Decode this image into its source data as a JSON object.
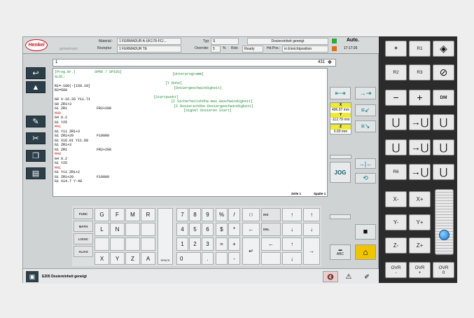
{
  "header": {
    "brand": "Henkel",
    "sub": "gemeinsam",
    "material_label": "Material :",
    "material_value": "1  FERMADUR A-UK178-FC/...",
    "rezeptur_label": "Rezeptur",
    "rezeptur_value": "1  FERMADUR TE",
    "typ_label": "Typ:",
    "typ_value": "S",
    "override_label": "Override:",
    "override_value": "5",
    "override_unit": "%",
    "rob_label": "Rob:",
    "rob_value": "Ready",
    "dosier_value": "Dosiereinheit geneigt",
    "hdpos_label": "Hd.Pos.:",
    "hdpos_value": "in Einrichtposition",
    "mode": "Auto.",
    "time": "17:17:26"
  },
  "toolbar": {
    "field": "1",
    "counter": "431"
  },
  "program": [
    {
      "t": "[Prog.Nr.]         SPR8 / SP10S]",
      "c": "#208a39"
    },
    {
      "t": "%LOC:",
      "c": "#208a39"
    },
    {
      "t": "",
      "c": "#000"
    },
    {
      "t": "R1=-100(-[159.10]",
      "c": "#000"
    },
    {
      "t": "R2=500",
      "c": "#000"
    },
    {
      "t": "",
      "c": "#000"
    },
    {
      "t": "G0 X-16.26 Y11.71",
      "c": "#000"
    },
    {
      "t": "G0 ZR1+3",
      "c": "#000"
    },
    {
      "t": "G1 ZR1              FR2+200",
      "c": "#000"
    },
    {
      "t": "M40",
      "c": "#c21818"
    },
    {
      "t": "G4 0.2",
      "c": "#000"
    },
    {
      "t": "G1 Y25",
      "c": "#000"
    },
    {
      "t": "M41",
      "c": "#c21818"
    },
    {
      "t": "G1 Y11 ZR1+3",
      "c": "#000"
    },
    {
      "t": "G1 ZR1+20           F10000",
      "c": "#000"
    },
    {
      "t": "G1 X16.01 Y11.68",
      "c": "#000"
    },
    {
      "t": "G1 ZR1+3",
      "c": "#000"
    },
    {
      "t": "G1 ZR1              FR2+200",
      "c": "#000"
    },
    {
      "t": "M40",
      "c": "#c21818"
    },
    {
      "t": "G4 0.2",
      "c": "#000"
    },
    {
      "t": "G1 Y25",
      "c": "#000"
    },
    {
      "t": "M41",
      "c": "#c21818"
    },
    {
      "t": "G1 Y11 ZR1+2",
      "c": "#000"
    },
    {
      "t": "G1 ZR1+20           F10000",
      "c": "#000"
    },
    {
      "t": "G1 X14.7 Y-48",
      "c": "#000"
    }
  ],
  "comments": [
    "[Unterprogramm]",
    "[Y Rohe]",
    "[Dosiergeschwindigkeit]",
    "[Startpunkt]",
    "[Z Sicherheitshöhe-max.Geschwindigkeit]",
    "[Z Dosierschöhe-Dosiergeschwindigkeit]",
    "[Signal Dosieren Start]"
  ],
  "editor_footer": {
    "line": "Zeile 1",
    "col": "Spalte 1"
  },
  "axes": [
    {
      "name": "X",
      "value": "496.07 mm"
    },
    {
      "name": "Y",
      "value": "-112.79 mm"
    },
    {
      "name": "Z",
      "value": "0.00 mm"
    }
  ],
  "jog": "JOG",
  "keyboard": {
    "func": [
      "FUNC",
      "MATH",
      "LOGIC",
      "ALIAS"
    ],
    "letters": [
      [
        "G",
        "F",
        "M",
        "R"
      ],
      [
        "L",
        "N",
        "",
        ""
      ],
      [
        "",
        "",
        "",
        ""
      ],
      [
        "X",
        "Y",
        "Z",
        "A"
      ]
    ],
    "space": "SPACE",
    "digits": [
      "7",
      "8",
      "9",
      "4",
      "5",
      "6",
      "1",
      "2",
      "3",
      "0",
      ".",
      ""
    ],
    "ops": [
      "%",
      "/",
      "$",
      "*",
      "=",
      "+",
      "",
      "-"
    ],
    "nav": [
      "( )",
      "INS",
      "DEL"
    ],
    "abc": "ABC"
  },
  "status": {
    "message": "E205 Dosiereinheit geneigt"
  },
  "panel": {
    "r1": "R1",
    "r2": "R2",
    "r3": "R3",
    "r6": "R6",
    "dm": "DM",
    "minus": "−",
    "plus": "+",
    "xm": "X-",
    "xp": "X+",
    "ym": "Y-",
    "yp": "Y+",
    "zm": "Z-",
    "zp": "Z+",
    "ovr1": "OVR\n-",
    "ovr2": "OVR\n+",
    "ovr3": "OVR\n0",
    "home": "HOME"
  }
}
